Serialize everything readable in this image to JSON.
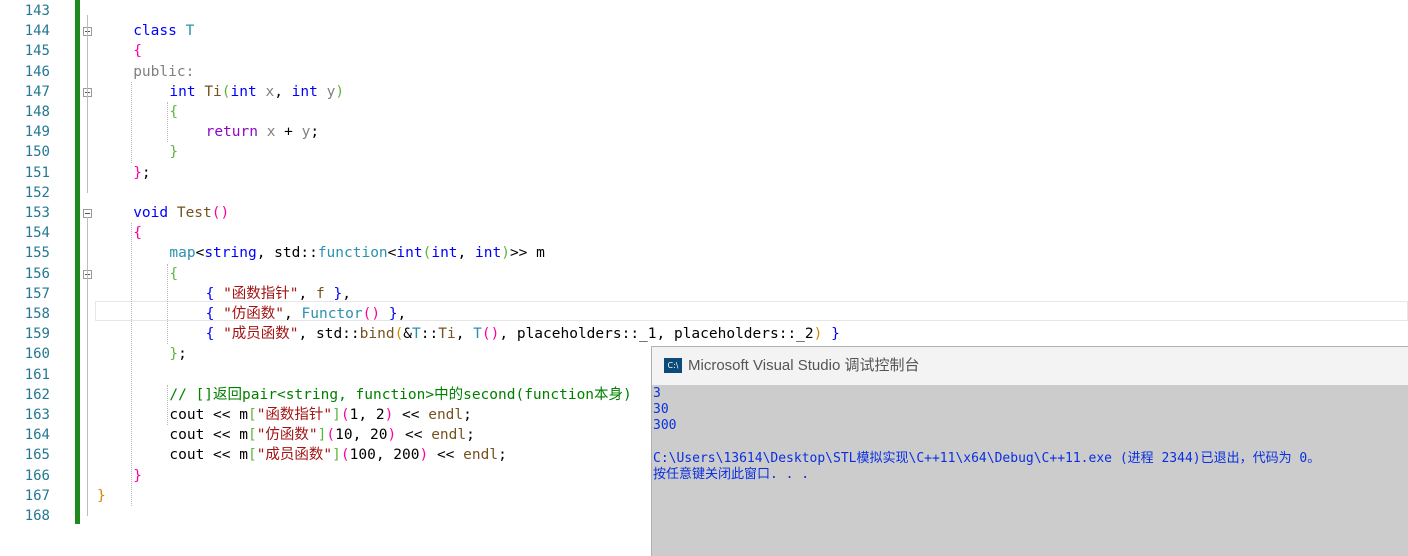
{
  "editor": {
    "lines": [
      {
        "num": "143"
      },
      {
        "num": "144",
        "tokens": [
          [
            "kw",
            "class"
          ],
          [
            "nm",
            " "
          ],
          [
            "ty",
            "T"
          ]
        ]
      },
      {
        "num": "145",
        "tokens": [
          [
            "br1",
            "{"
          ]
        ]
      },
      {
        "num": "146",
        "tokens": [
          [
            "pa",
            "public:"
          ]
        ]
      },
      {
        "num": "147",
        "tokens": [
          [
            "kw",
            "int"
          ],
          [
            "nm",
            " "
          ],
          [
            "fn",
            "Ti"
          ],
          [
            "br2",
            "("
          ],
          [
            "kw",
            "int"
          ],
          [
            "nm",
            " "
          ],
          [
            "pa",
            "x"
          ],
          [
            "nm",
            ", "
          ],
          [
            "kw",
            "int"
          ],
          [
            "nm",
            " "
          ],
          [
            "pa",
            "y"
          ],
          [
            "br2",
            ")"
          ]
        ]
      },
      {
        "num": "148",
        "tokens": [
          [
            "br2",
            "{"
          ]
        ]
      },
      {
        "num": "149",
        "tokens": [
          [
            "kw2",
            "return"
          ],
          [
            "nm",
            " "
          ],
          [
            "pa",
            "x"
          ],
          [
            "nm",
            " + "
          ],
          [
            "pa",
            "y"
          ],
          [
            "nm",
            ";"
          ]
        ]
      },
      {
        "num": "150",
        "tokens": [
          [
            "br2",
            "}"
          ]
        ]
      },
      {
        "num": "151",
        "tokens": [
          [
            "br1",
            "}"
          ],
          [
            "nm",
            ";"
          ]
        ]
      },
      {
        "num": "152"
      },
      {
        "num": "153",
        "tokens": [
          [
            "kw",
            "void"
          ],
          [
            "nm",
            " "
          ],
          [
            "fn",
            "Test"
          ],
          [
            "br1",
            "()"
          ]
        ]
      },
      {
        "num": "154",
        "tokens": [
          [
            "br1",
            "{"
          ]
        ]
      },
      {
        "num": "155",
        "tokens": [
          [
            "ty",
            "map"
          ],
          [
            "nm",
            "<"
          ],
          [
            "kw",
            "string"
          ],
          [
            "nm",
            ", std::"
          ],
          [
            "ty",
            "function"
          ],
          [
            "nm",
            "<"
          ],
          [
            "kw",
            "int"
          ],
          [
            "br2",
            "("
          ],
          [
            "kw",
            "int"
          ],
          [
            "nm",
            ", "
          ],
          [
            "kw",
            "int"
          ],
          [
            "br2",
            ")"
          ],
          [
            "nm",
            ">> m"
          ]
        ]
      },
      {
        "num": "156",
        "tokens": [
          [
            "br2",
            "{"
          ]
        ]
      },
      {
        "num": "157",
        "tokens": [
          [
            "kw",
            "{"
          ],
          [
            "nm",
            " "
          ],
          [
            "str",
            "\"函数指针\""
          ],
          [
            "nm",
            ", "
          ],
          [
            "fn",
            "f"
          ],
          [
            "nm",
            " "
          ],
          [
            "kw",
            "}"
          ],
          [
            "nm",
            ","
          ]
        ]
      },
      {
        "num": "158",
        "tokens": [
          [
            "kw",
            "{"
          ],
          [
            "nm",
            " "
          ],
          [
            "str",
            "\"仿函数\""
          ],
          [
            "nm",
            ", "
          ],
          [
            "ty",
            "Functor"
          ],
          [
            "br1",
            "()"
          ],
          [
            "nm",
            " "
          ],
          [
            "kw",
            "}"
          ],
          [
            "nm",
            ","
          ]
        ]
      },
      {
        "num": "159",
        "tokens": [
          [
            "kw",
            "{"
          ],
          [
            "nm",
            " "
          ],
          [
            "str",
            "\"成员函数\""
          ],
          [
            "nm",
            ", std::"
          ],
          [
            "fn",
            "bind"
          ],
          [
            "br3",
            "("
          ],
          [
            "nm",
            "&"
          ],
          [
            "ty",
            "T"
          ],
          [
            "nm",
            "::"
          ],
          [
            "fn",
            "Ti"
          ],
          [
            "nm",
            ", "
          ],
          [
            "ty",
            "T"
          ],
          [
            "br1",
            "()"
          ],
          [
            "nm",
            ", placeholders::_1, placeholders::_2"
          ],
          [
            "br3",
            ")"
          ],
          [
            "nm",
            " "
          ],
          [
            "kw",
            "}"
          ]
        ]
      },
      {
        "num": "160",
        "tokens": [
          [
            "br2",
            "}"
          ],
          [
            "nm",
            ";"
          ]
        ]
      },
      {
        "num": "161"
      },
      {
        "num": "162",
        "tokens": [
          [
            "cm",
            "// []返回pair<string, function>中的second(function本身)"
          ]
        ]
      },
      {
        "num": "163",
        "tokens": [
          [
            "nm",
            "cout << "
          ],
          [
            "nm",
            "m"
          ],
          [
            "br2",
            "["
          ],
          [
            "str",
            "\"函数指针\""
          ],
          [
            "br2",
            "]"
          ],
          [
            "br1",
            "("
          ],
          [
            "nm",
            "1, 2"
          ],
          [
            "br1",
            ")"
          ],
          [
            "nm",
            " << "
          ],
          [
            "fn",
            "endl"
          ],
          [
            "nm",
            ";"
          ]
        ]
      },
      {
        "num": "164",
        "tokens": [
          [
            "nm",
            "cout << "
          ],
          [
            "nm",
            "m"
          ],
          [
            "br2",
            "["
          ],
          [
            "str",
            "\"仿函数\""
          ],
          [
            "br2",
            "]"
          ],
          [
            "br1",
            "("
          ],
          [
            "nm",
            "10, 20"
          ],
          [
            "br1",
            ")"
          ],
          [
            "nm",
            " << "
          ],
          [
            "fn",
            "endl"
          ],
          [
            "nm",
            ";"
          ]
        ]
      },
      {
        "num": "165",
        "tokens": [
          [
            "nm",
            "cout << "
          ],
          [
            "nm",
            "m"
          ],
          [
            "br2",
            "["
          ],
          [
            "str",
            "\"成员函数\""
          ],
          [
            "br2",
            "]"
          ],
          [
            "br1",
            "("
          ],
          [
            "nm",
            "100, 200"
          ],
          [
            "br1",
            ")"
          ],
          [
            "nm",
            " << "
          ],
          [
            "fn",
            "endl"
          ],
          [
            "nm",
            ";"
          ]
        ]
      },
      {
        "num": "166",
        "tokens": [
          [
            "br1",
            "}"
          ]
        ]
      },
      {
        "num": "167",
        "tokens": [
          [
            "br3",
            "}"
          ]
        ]
      },
      {
        "num": "168"
      }
    ]
  },
  "console": {
    "icon_text": "C:\\",
    "title": "Microsoft Visual Studio 调试控制台",
    "output": [
      "3",
      "30",
      "300",
      "",
      "C:\\Users\\13614\\Desktop\\STL模拟实现\\C++11\\x64\\Debug\\C++11.exe (进程 2344)已退出，代码为 0。",
      "按任意键关闭此窗口. . ."
    ]
  }
}
